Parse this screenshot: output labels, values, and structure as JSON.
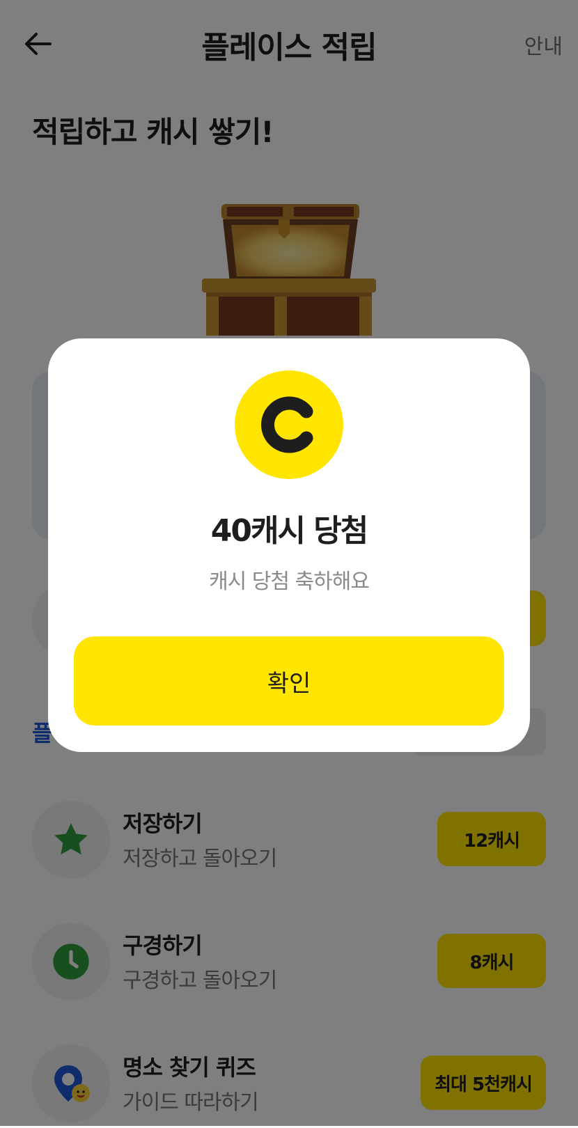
{
  "header": {
    "title": "플레이스 적립",
    "guide_label": "안내",
    "back_icon": "arrow-left-icon"
  },
  "hero": {
    "title": "적립하고 캐시 쌓기!",
    "image": "treasure-chest"
  },
  "section": {
    "title_partial": "플"
  },
  "tasks": [
    {
      "title": "저장하기",
      "subtitle": "저장하고 돌아오기",
      "reward": "12캐시",
      "icon": "star-icon",
      "icon_color": "#2e9e3e"
    },
    {
      "title": "구경하기",
      "subtitle": "구경하고 돌아오기",
      "reward": "8캐시",
      "icon": "clock-icon",
      "icon_color": "#2e9e3e"
    },
    {
      "title": "명소 찾기 퀴즈",
      "subtitle": "가이드 따라하기",
      "reward": "최대 5천캐시",
      "icon": "map-pin-smile-icon",
      "icon_color": "#1e5bd8"
    }
  ],
  "modal": {
    "coin_icon": "cash-coin-icon",
    "title": "40캐시 당첨",
    "subtitle": "캐시 당첨 축하해요",
    "confirm_label": "확인"
  },
  "colors": {
    "accent": "#ffe500",
    "text": "#1e1e1e",
    "muted": "#8a8a8a",
    "overlay": "rgba(0,0,0,0.5)"
  }
}
